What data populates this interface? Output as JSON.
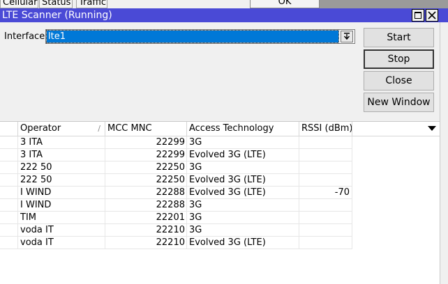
{
  "background": {
    "tabs": [
      "Cellular",
      "Status",
      "Traffic"
    ],
    "ok_label": "OK"
  },
  "window": {
    "title": "LTE Scanner (Running)",
    "title_bar_color": "#4a4ad6"
  },
  "interface": {
    "label": "Interface:",
    "value": "lte1"
  },
  "buttons": {
    "start": "Start",
    "stop": "Stop",
    "close": "Close",
    "new_window": "New Window"
  },
  "table": {
    "columns": [
      "Operator",
      "MCC MNC",
      "Access Technology",
      "RSSI (dBm)"
    ],
    "rows": [
      {
        "operator": "3 ITA",
        "mcc_mnc": "22299",
        "tech": "3G",
        "rssi": ""
      },
      {
        "operator": "3 ITA",
        "mcc_mnc": "22299",
        "tech": "Evolved 3G (LTE)",
        "rssi": ""
      },
      {
        "operator": "222 50",
        "mcc_mnc": "22250",
        "tech": "3G",
        "rssi": ""
      },
      {
        "operator": "222 50",
        "mcc_mnc": "22250",
        "tech": "Evolved 3G (LTE)",
        "rssi": ""
      },
      {
        "operator": "I WIND",
        "mcc_mnc": "22288",
        "tech": "Evolved 3G (LTE)",
        "rssi": "-70"
      },
      {
        "operator": "I WIND",
        "mcc_mnc": "22288",
        "tech": "3G",
        "rssi": ""
      },
      {
        "operator": "TIM",
        "mcc_mnc": "22201",
        "tech": "3G",
        "rssi": ""
      },
      {
        "operator": "voda IT",
        "mcc_mnc": "22210",
        "tech": "3G",
        "rssi": ""
      },
      {
        "operator": "voda IT",
        "mcc_mnc": "22210",
        "tech": "Evolved 3G (LTE)",
        "rssi": ""
      }
    ]
  }
}
